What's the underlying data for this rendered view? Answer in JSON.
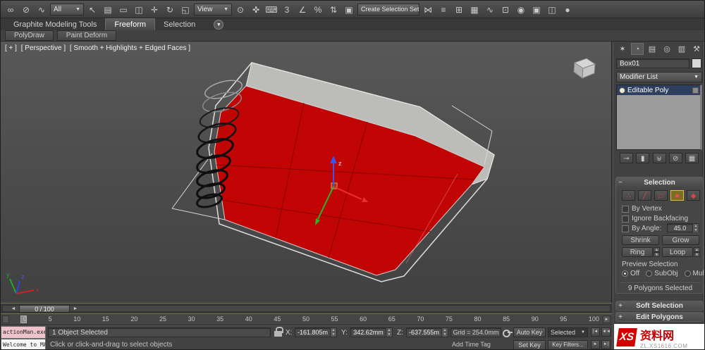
{
  "colors": {
    "object_red": "#c10505",
    "band_gray": "#bcbcb8",
    "watermark_red": "#d40000",
    "stack_selected": "#2e3e5e",
    "subobject_active_border": "#e0c040"
  },
  "ui": {
    "dd_arrow": "▼",
    "spinner_up": "▲",
    "spinner_down": "▼",
    "minus": "−",
    "plus": "+",
    "ribbon_toggle": "▼",
    "prev_arrow": "◄",
    "next_arrow": "►"
  },
  "toolbar": {
    "group_a": [
      {
        "name": "select-and-link-icon",
        "glyph": "∞"
      },
      {
        "name": "unlink-selection-icon",
        "glyph": "⊘"
      },
      {
        "name": "bind-to-spacewarp-icon",
        "glyph": "∿"
      }
    ],
    "filter_value": "All",
    "group_b": [
      {
        "name": "select-object-icon",
        "glyph": "↖"
      },
      {
        "name": "select-by-name-icon",
        "glyph": "▤"
      },
      {
        "name": "rectangular-selection-icon",
        "glyph": "▭"
      },
      {
        "name": "window-crossing-icon",
        "glyph": "◫"
      },
      {
        "name": "select-and-move-icon",
        "glyph": "✛"
      },
      {
        "name": "select-and-rotate-icon",
        "glyph": "↻"
      },
      {
        "name": "select-and-scale-icon",
        "glyph": "◱"
      }
    ],
    "coord_value": "View",
    "group_c": [
      {
        "name": "use-pivot-center-icon",
        "glyph": "⊙"
      },
      {
        "name": "select-and-manipulate-icon",
        "glyph": "✜"
      },
      {
        "name": "keyboard-override-icon",
        "glyph": "⌨"
      },
      {
        "name": "snaps-toggle-icon",
        "glyph": "3"
      },
      {
        "name": "angle-snap-icon",
        "glyph": "∠"
      },
      {
        "name": "percent-snap-icon",
        "glyph": "%"
      },
      {
        "name": "spinner-snap-icon",
        "glyph": "⇅"
      },
      {
        "name": "edit-named-sets-icon",
        "glyph": "▣"
      }
    ],
    "selset_value": "Create Selection Set",
    "group_d": [
      {
        "name": "mirror-icon",
        "glyph": "⋈"
      },
      {
        "name": "align-icon",
        "glyph": "≡"
      },
      {
        "name": "layer-manager-icon",
        "glyph": "⊞"
      },
      {
        "name": "graphite-toggle-icon",
        "glyph": "▦"
      },
      {
        "name": "curve-editor-icon",
        "glyph": "∿"
      },
      {
        "name": "schematic-view-icon",
        "glyph": "⊡"
      },
      {
        "name": "material-editor-icon",
        "glyph": "◉"
      },
      {
        "name": "render-setup-icon",
        "glyph": "▣"
      },
      {
        "name": "rendered-frame-icon",
        "glyph": "◫"
      },
      {
        "name": "render-production-icon",
        "glyph": "●"
      }
    ]
  },
  "ribbon": {
    "tabs": [
      "Graphite Modeling Tools",
      "Freeform",
      "Selection"
    ],
    "active_tab": "Freeform",
    "panels": [
      "PolyDraw",
      "Paint Deform"
    ]
  },
  "viewport": {
    "plus": "[ + ]",
    "view": "[ Perspective ]",
    "shading": "[ Smooth + Highlights + Edged Faces ]",
    "gizmo_z": "z",
    "axis_x": "x",
    "axis_y": "y",
    "axis_z": "z"
  },
  "timeline": {
    "slider_label": "0 / 100",
    "ticks": [
      "0",
      "5",
      "10",
      "15",
      "20",
      "25",
      "30",
      "35",
      "40",
      "45",
      "50",
      "55",
      "60",
      "65",
      "70",
      "75",
      "80",
      "85",
      "90",
      "95",
      "100"
    ]
  },
  "status": {
    "macro_line": "actionMan.exec",
    "listener_line": "Welcome to MAX!",
    "selection": "1 Object Selected",
    "prompt": "Click or click-and-drag to select objects",
    "x_label": "X:",
    "x_value": "-161.805m",
    "y_label": "Y:",
    "y_value": "342.62mm",
    "z_label": "Z:",
    "z_value": "-637.555m",
    "grid": "Grid = 254.0mm",
    "add_time_tag": "Add Time Tag",
    "auto_key": "Auto Key",
    "set_key": "Set Key",
    "selected_dropdown": "Selected",
    "key_filters": "Key Filters...",
    "jump1": "|◄",
    "jump2": "◄◄",
    "play1": "►",
    "play2": "►|"
  },
  "command_panel": {
    "tabs": [
      {
        "name": "create-tab-icon",
        "glyph": "✶"
      },
      {
        "name": "modify-tab-icon",
        "glyph": "◔"
      },
      {
        "name": "hierarchy-tab-icon",
        "glyph": "▤"
      },
      {
        "name": "motion-tab-icon",
        "glyph": "◎"
      },
      {
        "name": "display-tab-icon",
        "glyph": "▥"
      },
      {
        "name": "utilities-tab-icon",
        "glyph": "⚒"
      }
    ],
    "object_name": "Box01",
    "modifier_list": "Modifier List",
    "stack_rows": [
      {
        "label": "Editable Poly"
      }
    ],
    "stack_tools": [
      {
        "name": "pin-stack-icon",
        "glyph": "⊸"
      },
      {
        "name": "show-end-result-icon",
        "glyph": "▮"
      },
      {
        "name": "make-unique-icon",
        "glyph": "⊎"
      },
      {
        "name": "remove-modifier-icon",
        "glyph": "⊘"
      },
      {
        "name": "configure-modifier-sets-icon",
        "glyph": "▦"
      }
    ],
    "rollouts_closed": [
      {
        "name": "soft-selection-rollout",
        "expand": "+",
        "title": "Soft Selection"
      },
      {
        "name": "edit-polygons-rollout",
        "expand": "+",
        "title": "Edit Polygons"
      }
    ]
  },
  "selection_rollout": {
    "collapse_glyph": "−",
    "title": "Selection",
    "subobject_icons": [
      {
        "name": "vertex-mode-icon",
        "glyph": "∴"
      },
      {
        "name": "edge-mode-icon",
        "glyph": "╱"
      },
      {
        "name": "border-mode-icon",
        "glyph": "□"
      },
      {
        "name": "polygon-mode-icon",
        "glyph": "■"
      },
      {
        "name": "element-mode-icon",
        "glyph": "◆"
      }
    ],
    "active_mode": "polygon",
    "by_vertex": "By Vertex",
    "ignore_backfacing": "Ignore Backfacing",
    "by_angle": "By Angle:",
    "angle_value": "45.0",
    "shrink": "Shrink",
    "grow": "Grow",
    "ring": "Ring",
    "loop": "Loop",
    "preview_label": "Preview Selection",
    "preview_options": [
      "Off",
      "SubObj",
      "Multi"
    ],
    "preview_selected": "Off",
    "status": "9 Polygons Selected"
  },
  "watermark": {
    "logo": "XS",
    "cn": "资料网",
    "site": "ZL.XS1616.COM"
  }
}
